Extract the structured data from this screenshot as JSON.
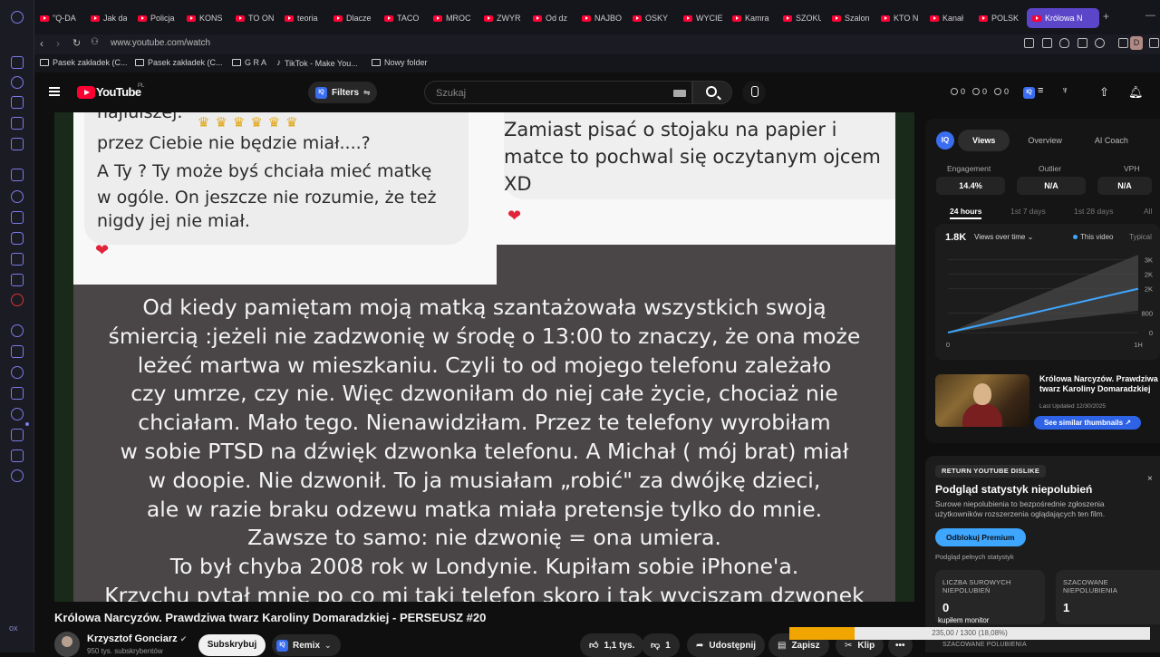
{
  "browser": {
    "tabs": [
      "\"Q-DA",
      "Jak da",
      "Policja",
      "KONS",
      "TO ON",
      "teoria",
      "Dlacze",
      "TACO",
      "MROC",
      "ZWYR",
      "Od dz",
      "NAJBO",
      "OSKY",
      "WYCIE",
      "Kamra",
      "SZOKU",
      "Szalon",
      "KTO N",
      "Kanał",
      "POLSK"
    ],
    "active_tab": "Królowa N",
    "new_tab": "+",
    "url": "www.youtube.com/watch",
    "profile_letter": "D",
    "bookmarks": [
      "Pasek zakładek (C...",
      "Pasek zakładek (C...",
      "G R A",
      "TikTok - Make You...",
      "Nowy folder"
    ],
    "sidebar_bottom": "ox"
  },
  "youtube": {
    "logo_text": "YouTube",
    "logo_region": "PL",
    "filters_label": "Filters",
    "iq_label": "IQ",
    "search_placeholder": "Szukaj",
    "header_stats": [
      "0",
      "0",
      "0"
    ]
  },
  "video": {
    "left_chat": [
      "przez Ciebie nie będzie miał....?",
      "A Ty ? Ty może byś chciała mieć matkę",
      "w ogóle. On jeszcze nie rozumie, że też",
      "nigdy jej nie miał."
    ],
    "left_chat_cut": "najlulszej.",
    "right_chat": [
      "Zamiast pisać o stojaku na papier i",
      "matce to pochwal się oczytanym ojcem",
      "XD"
    ],
    "story": [
      "Od kiedy pamiętam moją matką szantażowała wszystkich swoją",
      "śmiercią :jeżeli nie zadzwonię w środę o 13:00 to znaczy, że ona może",
      "leżeć martwa w mieszkaniu. Czyli to od mojego telefonu zależało",
      "czy umrze, czy nie. Więc dzwoniłam do niej całe życie, chociaż nie",
      "chciałam. Mało tego. Nienawidziłam. Przez te telefony wyrobiłam",
      "w sobie PTSD na dźwięk dzwonka telefonu. A Michał ( mój brat) miał",
      "w doopie. Nie dzwonił. To ja musiałam „robić\" za dwójkę dzieci,",
      "ale w razie braku odzewu matka miała pretensje tylko do mnie.",
      "Zawsze to samo: nie dzwonię = ona umiera.",
      "To był chyba 2008 rok w Londynie. Kupiłam sobie iPhone'a.",
      "Krzychu pytał mnie po co mi taki telefon skoro i tak wyciszam dzwonek"
    ]
  },
  "below_video": {
    "title": "Królowa Narcyzów. Prawdziwa twarz Karoliny Domaradzkiej - PERSEUSZ #20",
    "channel": "Krzysztof Gonciarz",
    "subs": "950 tys. subskrybentów",
    "subscribe": "Subskrybuj",
    "remix": "Remix",
    "likes": "1,1 tys.",
    "dislikes": "1",
    "share": "Udostępnij",
    "save": "Zapisz",
    "clip": "Klip",
    "more": "•••",
    "progress_text": "235,00 / 1300 (18,08%)",
    "progress_fraction": 0.1808
  },
  "right_panel": {
    "tabs": [
      "Views",
      "Overview",
      "AI Coach"
    ],
    "metrics": [
      {
        "label": "Engagement",
        "value": "14.4%"
      },
      {
        "label": "Outlier",
        "value": "N/A"
      },
      {
        "label": "VPH",
        "value": "N/A"
      }
    ],
    "ranges": [
      "24 hours",
      "1st 7 days",
      "1st 28 days",
      "All"
    ],
    "views_total": "1.8K",
    "views_dropdown": "Views over time",
    "legend_this": "This video",
    "legend_typical": "Typical",
    "thumb_title": "Królowa Narcyzów. Prawdziwa twarz Karoliny Domaradzkiej",
    "thumb_date": "Last Updated 12/30/2025",
    "similar_btn": "See similar thumbnails ↗"
  },
  "chart_data": {
    "type": "line",
    "title": "",
    "xlabel": "",
    "ylabel": "",
    "x_ticks": [
      "0",
      "1H"
    ],
    "y_ticks": [
      "0",
      "800",
      "2K",
      "2K",
      "3K"
    ],
    "series": [
      {
        "name": "This video",
        "x": [
          0,
          1
        ],
        "values": [
          0,
          1800
        ],
        "color": "#3ea6ff"
      },
      {
        "name": "Typical",
        "x": [
          0,
          1
        ],
        "band_low": [
          0,
          900
        ],
        "band_high": [
          0,
          3200
        ],
        "color": "#555555"
      }
    ],
    "xlim": [
      0,
      1
    ],
    "ylim": [
      0,
      3200
    ]
  },
  "dislike_panel": {
    "tag": "RETURN YOUTUBE DISLIKE",
    "close": "×",
    "title": "Podgląd statystyk niepolubień",
    "desc": "Surowe niepolubienia to bezpośrednie zgłoszenia użytkowników rozszerzenia oglądających ten film.",
    "button": "Odblokuj Premium",
    "link": "Podgląd pełnych statystyk",
    "box1_label": "LICZBA SUROWYCH NIEPOLUBIEŃ",
    "box1_value": "0",
    "box2_label": "SZACOWANE NIEPOLUBIENIA",
    "box2_value": "1",
    "monitor": "kupiłem monitor",
    "sub": "SZACOWANE POLUBIENIA"
  },
  "colors": {
    "accent": "#3ea6ff",
    "yt_red": "#ff0033",
    "browser_active_tab": "#5b45c8",
    "progress": "#f0a500"
  }
}
